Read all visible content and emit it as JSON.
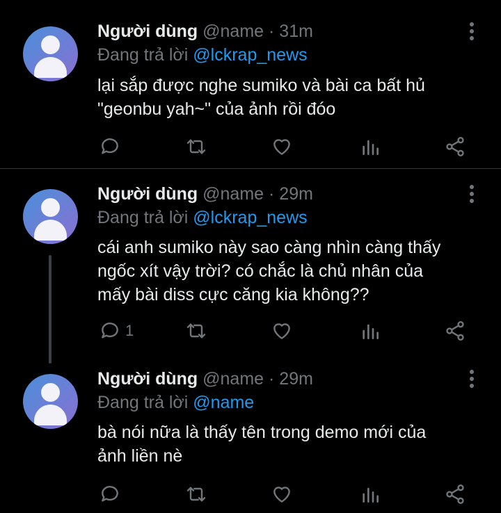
{
  "colors": {
    "background": "#000000",
    "accent": "#1d9bf0",
    "muted": "#71767b",
    "text": "#e7e9ea"
  },
  "icons": [
    "avatar",
    "more-vert-icon",
    "reply-icon",
    "retweet-icon",
    "like-icon",
    "stats-icon",
    "share-icon"
  ],
  "tweets": [
    {
      "name": "Người dùng",
      "handle": "@name",
      "sep": "·",
      "time": "31m",
      "reply_prefix": "Đang trả lời",
      "reply_to": "@lckrap_news",
      "lines": [
        "lại sắp được nghe sumiko và bài ca bất hủ",
        "\"geonbu yah~\" của ảnh rồi đóo"
      ],
      "reply_count": ""
    },
    {
      "name": "Người dùng",
      "handle": "@name",
      "sep": "·",
      "time": "29m",
      "reply_prefix": "Đang trả lời",
      "reply_to": "@lckrap_news",
      "lines": [
        "cái anh sumiko này sao càng nhìn càng thấy",
        "ngốc xít vậy trời? có chắc là chủ nhân của",
        "mấy bài diss cực căng kia không??"
      ],
      "reply_count": "1"
    },
    {
      "name": "Người dùng",
      "handle": "@name",
      "sep": "·",
      "time": "29m",
      "reply_prefix": "Đang trả lời",
      "reply_to": "@name",
      "lines": [
        "bà nói nữa là thấy tên trong demo mới của",
        "ảnh liền nè"
      ],
      "reply_count": ""
    }
  ]
}
